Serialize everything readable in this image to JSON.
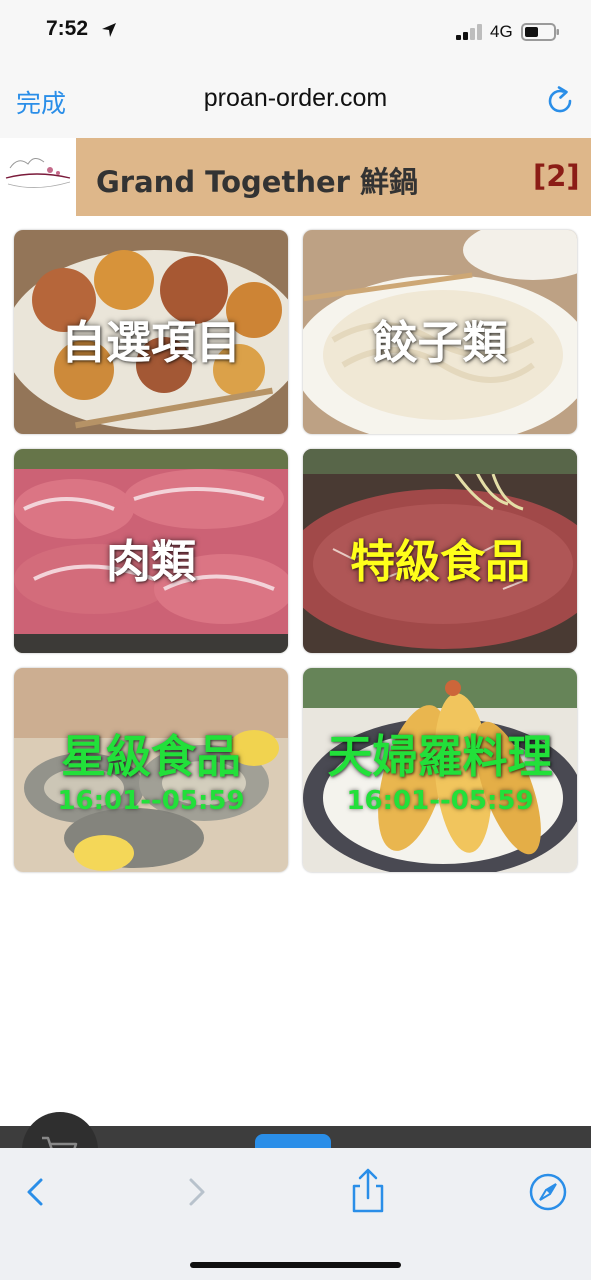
{
  "status_bar": {
    "time": "7:52",
    "network": "4G",
    "location_icon": "location-arrow-icon",
    "signal_icon": "signal-bars-icon",
    "battery_icon": "battery-icon"
  },
  "browser": {
    "done_label": "完成",
    "url": "proan-order.com",
    "reload_icon": "reload-icon",
    "accent_color": "#2a8ee8"
  },
  "store": {
    "title": "Grand Together 鮮鍋",
    "cart_count": "[2]",
    "logo_icon": "together-logo",
    "header_color": "#deb78a"
  },
  "categories": [
    {
      "label": "自選項目",
      "label_color": "#ffffff",
      "time": "",
      "image": "fried-chicken-platter"
    },
    {
      "label": "餃子類",
      "label_color": "#ffffff",
      "time": "",
      "image": "udon-noodles"
    },
    {
      "label": "肉類",
      "label_color": "#ffffff",
      "time": "",
      "image": "sliced-meat-rolls"
    },
    {
      "label": "特級食品",
      "label_color": "#ffff1a",
      "time": "",
      "image": "marbled-beef"
    },
    {
      "label": "星級食品",
      "label_color": "#22e03a",
      "time": "16:01--05:59",
      "image": "oysters"
    },
    {
      "label": "天婦羅料理",
      "label_color": "#22e03a",
      "time": "16:01--05:59",
      "image": "tempura-shrimp"
    }
  ],
  "toolbar": {
    "back_icon": "back-chevron-icon",
    "forward_icon": "forward-chevron-icon",
    "share_icon": "share-icon",
    "compass_icon": "compass-icon",
    "cart_icon": "cart-icon"
  }
}
